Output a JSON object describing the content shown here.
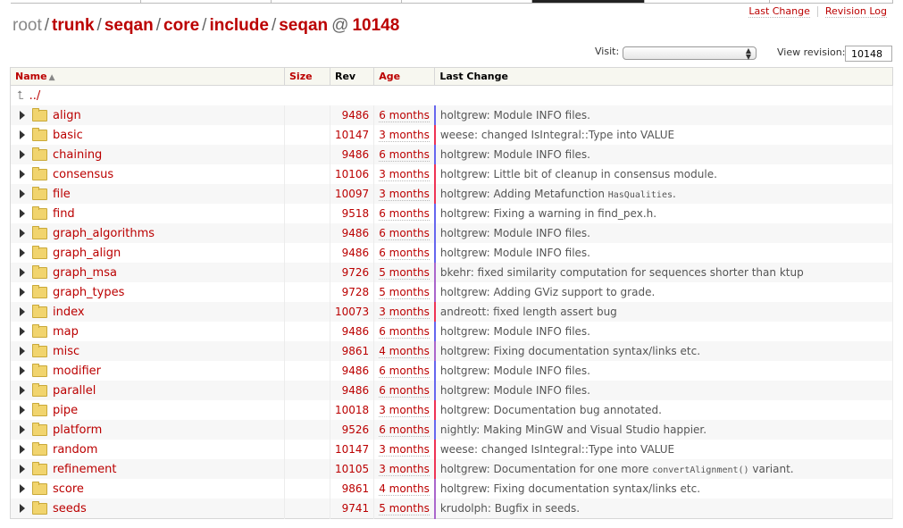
{
  "context_nav": {
    "last_change": "Last Change",
    "revision_log": "Revision Log"
  },
  "path": {
    "root": "root",
    "segments": [
      "trunk",
      "seqan",
      "core",
      "include",
      "seqan"
    ],
    "at": "@",
    "revision": "10148"
  },
  "visit": {
    "label": "Visit:",
    "selected": ""
  },
  "view_revision": {
    "label": "View revision:",
    "value": "10148"
  },
  "columns": {
    "name": "Name",
    "sort_icon": "sort-ascending-icon",
    "size": "Size",
    "rev": "Rev",
    "age": "Age",
    "last_change": "Last Change"
  },
  "parent_link": "../",
  "colors": {
    "link": "#bb0000",
    "age_recent": "#ee3355",
    "age_mid": "#aa66cc",
    "age_old": "#6666ee"
  },
  "rows": [
    {
      "name": "align",
      "rev": "9486",
      "age": "6 months",
      "change": "holtgrew: Module INFO files."
    },
    {
      "name": "basic",
      "rev": "10147",
      "age": "3 months",
      "change": "weese: changed IsIntegral::Type into VALUE"
    },
    {
      "name": "chaining",
      "rev": "9486",
      "age": "6 months",
      "change": "holtgrew: Module INFO files."
    },
    {
      "name": "consensus",
      "rev": "10106",
      "age": "3 months",
      "change": "holtgrew: Little bit of cleanup in consensus module."
    },
    {
      "name": "file",
      "rev": "10097",
      "age": "3 months",
      "change": "holtgrew: Adding Metafunction ",
      "code": "HasQualities",
      "tail": "."
    },
    {
      "name": "find",
      "rev": "9518",
      "age": "6 months",
      "change": "holtgrew: Fixing a warning in find_pex.h."
    },
    {
      "name": "graph_algorithms",
      "rev": "9486",
      "age": "6 months",
      "change": "holtgrew: Module INFO files."
    },
    {
      "name": "graph_align",
      "rev": "9486",
      "age": "6 months",
      "change": "holtgrew: Module INFO files."
    },
    {
      "name": "graph_msa",
      "rev": "9726",
      "age": "5 months",
      "change": "bkehr: fixed similarity computation for sequences shorter than ktup"
    },
    {
      "name": "graph_types",
      "rev": "9728",
      "age": "5 months",
      "change": "holtgrew: Adding GViz support to grade."
    },
    {
      "name": "index",
      "rev": "10073",
      "age": "3 months",
      "change": "andreott: fixed length assert bug"
    },
    {
      "name": "map",
      "rev": "9486",
      "age": "6 months",
      "change": "holtgrew: Module INFO files."
    },
    {
      "name": "misc",
      "rev": "9861",
      "age": "4 months",
      "change": "holtgrew: Fixing documentation syntax/links etc."
    },
    {
      "name": "modifier",
      "rev": "9486",
      "age": "6 months",
      "change": "holtgrew: Module INFO files."
    },
    {
      "name": "parallel",
      "rev": "9486",
      "age": "6 months",
      "change": "holtgrew: Module INFO files."
    },
    {
      "name": "pipe",
      "rev": "10018",
      "age": "3 months",
      "change": "holtgrew: Documentation bug annotated."
    },
    {
      "name": "platform",
      "rev": "9526",
      "age": "6 months",
      "change": "nightly: Making MinGW and Visual Studio happier."
    },
    {
      "name": "random",
      "rev": "10147",
      "age": "3 months",
      "change": "weese: changed IsIntegral::Type into VALUE"
    },
    {
      "name": "refinement",
      "rev": "10105",
      "age": "3 months",
      "change": "holtgrew: Documentation for one more ",
      "code": "convertAlignment()",
      "tail": " variant."
    },
    {
      "name": "score",
      "rev": "9861",
      "age": "4 months",
      "change": "holtgrew: Fixing documentation syntax/links etc."
    },
    {
      "name": "seeds",
      "rev": "9741",
      "age": "5 months",
      "change": "krudolph: Bugfix in seeds."
    }
  ]
}
